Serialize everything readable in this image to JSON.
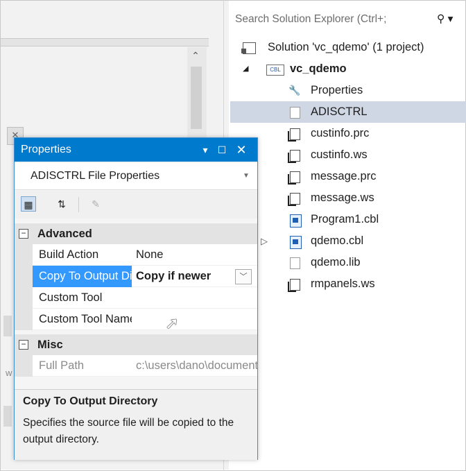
{
  "solution_explorer": {
    "search_placeholder": "Search Solution Explorer (Ctrl+;",
    "search_icon": "search-icon",
    "solution_label": "Solution 'vc_qdemo' (1 project)",
    "project_label": "vc_qdemo",
    "project_icon_text": "CBL",
    "items": [
      {
        "label": "Properties",
        "icon": "wrench-icon"
      },
      {
        "label": "ADISCTRL",
        "icon": "file-icon",
        "selected": true
      },
      {
        "label": "custinfo.prc",
        "icon": "copy-file-icon"
      },
      {
        "label": "custinfo.ws",
        "icon": "copy-file-icon"
      },
      {
        "label": "message.prc",
        "icon": "copy-file-icon"
      },
      {
        "label": "message.ws",
        "icon": "copy-file-icon"
      },
      {
        "label": "Program1.cbl",
        "icon": "cobol-file-icon"
      },
      {
        "label": "qdemo.cbl",
        "icon": "cobol-file-icon"
      },
      {
        "label": "qdemo.lib",
        "icon": "file-icon"
      },
      {
        "label": "rmpanels.ws",
        "icon": "copy-file-icon"
      }
    ]
  },
  "properties_window": {
    "title": "Properties",
    "object_selector": "ADISCTRL File Properties",
    "categories": [
      {
        "name": "Advanced",
        "rows": [
          {
            "name": "Build Action",
            "value": "None"
          },
          {
            "name": "Copy To Output Directory",
            "value": "Copy if newer"
          },
          {
            "name": "Custom Tool",
            "value": ""
          },
          {
            "name": "Custom Tool Namespace",
            "value": ""
          }
        ]
      },
      {
        "name": "Misc",
        "rows": [
          {
            "name": "Full Path",
            "value": "c:\\users\\dano\\documents"
          }
        ]
      }
    ],
    "description": {
      "title": "Copy To Output Directory",
      "text": "Specifies the source file will be copied to the output directory."
    }
  },
  "colors": {
    "accent": "#007acc",
    "selection": "#3399ff",
    "tree_selected": "#cfd7e4"
  }
}
